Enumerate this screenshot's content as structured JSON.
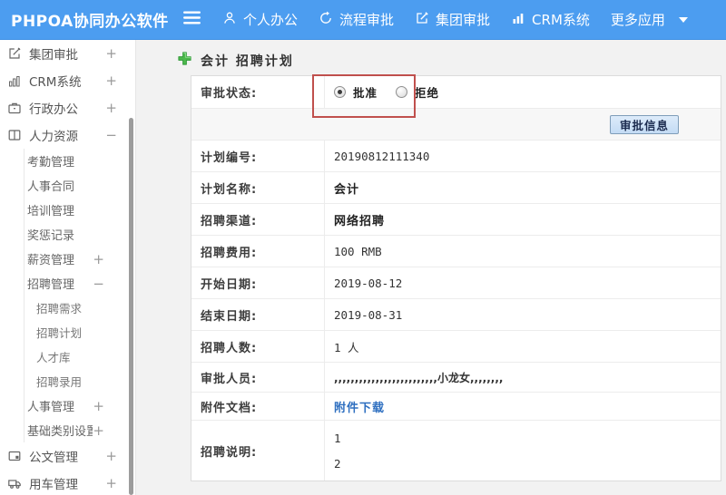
{
  "topbar": {
    "logo": "PHPOA协同办公软件",
    "nav": [
      {
        "label": "个人办公"
      },
      {
        "label": "流程审批"
      },
      {
        "label": "集团审批"
      },
      {
        "label": "CRM系统"
      },
      {
        "label": "更多应用"
      }
    ]
  },
  "sidebar": {
    "items": [
      {
        "label": "集团审批",
        "expander": "+"
      },
      {
        "label": "CRM系统",
        "expander": "+"
      },
      {
        "label": "行政办公",
        "expander": "+"
      },
      {
        "label": "人力资源",
        "expander": "−"
      },
      {
        "label": "考勤管理",
        "expander": ""
      },
      {
        "label": "人事合同",
        "expander": ""
      },
      {
        "label": "培训管理",
        "expander": ""
      },
      {
        "label": "奖惩记录",
        "expander": ""
      },
      {
        "label": "薪资管理",
        "expander": "+"
      },
      {
        "label": "招聘管理",
        "expander": "−"
      },
      {
        "label": "招聘需求",
        "expander": ""
      },
      {
        "label": "招聘计划",
        "expander": ""
      },
      {
        "label": "人才库",
        "expander": ""
      },
      {
        "label": "招聘录用",
        "expander": ""
      },
      {
        "label": "人事管理",
        "expander": "+"
      },
      {
        "label": "基础类别设置",
        "expander": "+"
      },
      {
        "label": "公文管理",
        "expander": "+"
      },
      {
        "label": "用车管理",
        "expander": "+"
      }
    ]
  },
  "main": {
    "page_title": "会计 招聘计划",
    "approval": {
      "label": "审批状态:",
      "options": [
        "批准",
        "拒绝"
      ],
      "selected": "批准"
    },
    "approve_info_button": "审批信息",
    "fields": [
      {
        "label": "计划编号:",
        "value": "20190812111340"
      },
      {
        "label": "计划名称:",
        "value": "会计"
      },
      {
        "label": "招聘渠道:",
        "value": "网络招聘"
      },
      {
        "label": "招聘费用:",
        "value": "100 RMB"
      },
      {
        "label": "开始日期:",
        "value": "2019-08-12"
      },
      {
        "label": "结束日期:",
        "value": "2019-08-31"
      },
      {
        "label": "招聘人数:",
        "value": "1 人"
      },
      {
        "label": "审批人员:",
        "value": ",,,,,,,,,,,,,,,,,,,,,,,,,小龙女,,,,,,,,"
      },
      {
        "label": "附件文档:",
        "value": "附件下载"
      },
      {
        "label": "招聘说明:",
        "value": "1\n2"
      }
    ]
  },
  "colors": {
    "topbar_blue": "#4c9df0",
    "link_blue": "#2e6fc0",
    "annotation_red": "#c0504d",
    "plus_green": "#4cb84c"
  }
}
